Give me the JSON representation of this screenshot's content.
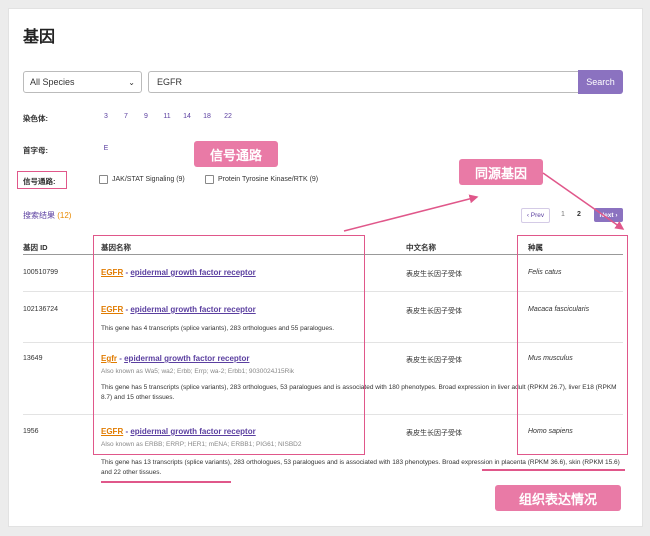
{
  "page": {
    "title": "基因"
  },
  "search": {
    "species_value": "All Species",
    "query_value": "EGFR",
    "button_label": "Search"
  },
  "filters": {
    "chromosome_label": "染色体:",
    "chromosomes": [
      "3",
      "7",
      "9",
      "11",
      "14",
      "18",
      "22"
    ],
    "initial_label": "首字母:",
    "initials": [
      "E"
    ],
    "pathway_label": "信号通路:",
    "pathways": [
      "JAK/STAT Signaling (9)",
      "Protein Tyrosine Kinase/RTK (9)"
    ]
  },
  "results": {
    "label": "搜索结果",
    "count": "(12)"
  },
  "pager": {
    "prev": "‹ Prev",
    "pages": [
      "1",
      "2"
    ],
    "current": "2",
    "next": "Next ›"
  },
  "table": {
    "headers": {
      "id": "基因 ID",
      "name": "基因名称",
      "cn": "中文名称",
      "species": "种属"
    },
    "rows": [
      {
        "id": "100510799",
        "symbol": "EGFR",
        "sep": " - ",
        "name": "epidermal growth factor receptor",
        "aka": "",
        "desc": "",
        "cn": "表皮生长因子受体",
        "species": "Felis catus"
      },
      {
        "id": "102136724",
        "symbol": "EGFR",
        "sep": " - ",
        "name": "epidermal growth factor receptor",
        "aka": "",
        "desc": "This gene has 4 transcripts (splice variants), 283 orthologues and 55 paralogues.",
        "cn": "表皮生长因子受体",
        "species": "Macaca fascicularis"
      },
      {
        "id": "13649",
        "symbol": "Egfr",
        "sep": " - ",
        "name": "epidermal growth factor receptor",
        "aka": "Also known as Wa5; wa2; Erbb; Errp; wa-2; Erbb1; 9030024J15Rik",
        "desc": "This gene has 5 transcripts (splice variants), 283 orthologues, 53 paralogues and is associated with 180 phenotypes. Broad expression in liver adult (RPKM 26.7), liver E18 (RPKM 8.7) and 15 other tissues.",
        "cn": "表皮生长因子受体",
        "species": "Mus musculus"
      },
      {
        "id": "1956",
        "symbol": "EGFR",
        "sep": " - ",
        "name": "epidermal growth factor receptor",
        "aka": "Also known as ERBB; ERRP; HER1; mENA; ERBB1; PIG61; NISBD2",
        "desc": "This gene has 13 transcripts (splice variants), 283 orthologues, 53 paralogues and is associated with 183 phenotypes. Broad expression in placenta (RPKM 36.6), skin (RPKM 15.6) and 22 other tissues.",
        "cn": "表皮生长因子受体",
        "species": "Homo sapiens"
      }
    ]
  },
  "annotations": {
    "pathway": "信号通路",
    "homolog": "同源基因",
    "tissue": "组织表达情况"
  },
  "colors": {
    "accent": "#8b72c0",
    "highlight": "#e97aa6",
    "symbol": "#e07b00"
  }
}
